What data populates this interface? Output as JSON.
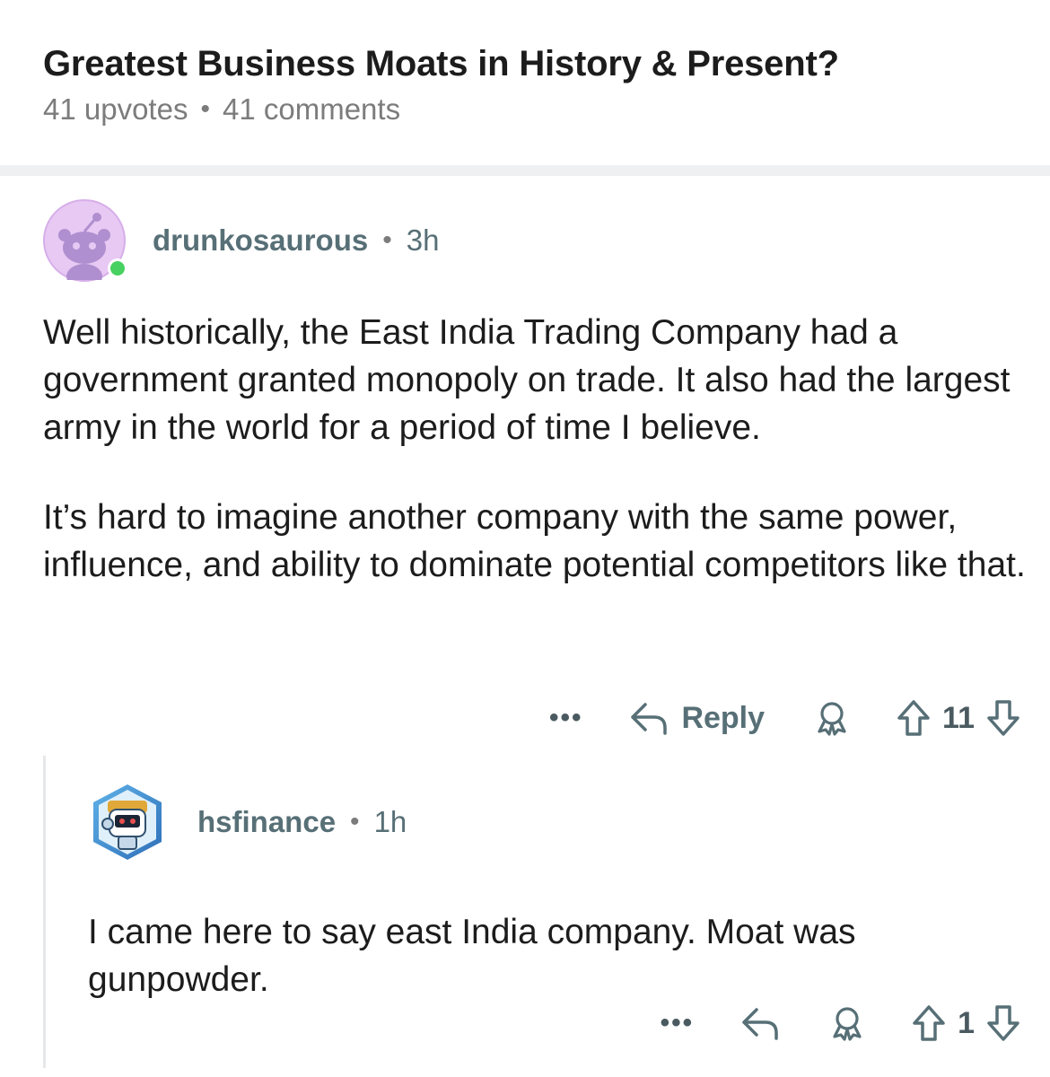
{
  "post": {
    "title": "Greatest Business Moats in History & Present?",
    "upvotes": "41 upvotes",
    "separator": "•",
    "comments": "41 comments"
  },
  "comments": [
    {
      "author": "drunkosaurous",
      "separator": "•",
      "age": "3h",
      "avatar_icon": "snoo-avatar",
      "online": true,
      "paragraphs": [
        "Well historically, the East India Trading Company had a government granted monopoly on trade. It also had the largest army in the world for a period of time I believe.",
        "It’s hard to imagine another company with the same power, influence, and ability to dominate potential competitors like that."
      ],
      "actions": {
        "more": "•••",
        "reply": "Reply",
        "score": "11"
      }
    },
    {
      "author": "hsfinance",
      "separator": "•",
      "age": "1h",
      "avatar_icon": "nft-robot-avatar",
      "paragraphs": [
        "I came here to say east India company. Moat was gunpowder."
      ],
      "actions": {
        "more": "•••",
        "score": "1"
      }
    }
  ],
  "colors": {
    "meta_gray": "#7c7c7c",
    "action_gray": "#576f76",
    "online_green": "#46d160",
    "divider": "#eef0f1",
    "avatar_bg": "#e7c9f3"
  }
}
